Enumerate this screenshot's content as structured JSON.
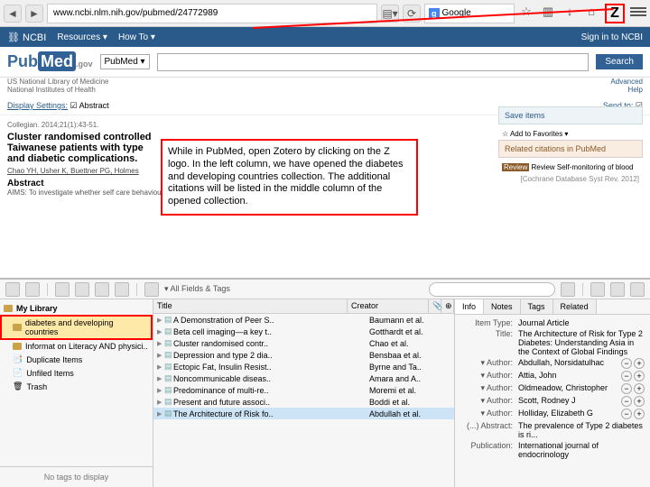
{
  "browser": {
    "url": "www.ncbi.nlm.nih.gov/pubmed/24772989",
    "search_engine": "Google",
    "search_prefix": "g"
  },
  "ncbi": {
    "brand": "NCBI",
    "resources": "Resources",
    "howto": "How To",
    "signin": "Sign in to NCBI"
  },
  "pubmed": {
    "logo_pub": "Pub",
    "logo_med": "Med",
    "logo_gov": ".gov",
    "select": "PubMed",
    "search_btn": "Search",
    "subtitle1": "US National Library of Medicine",
    "subtitle2": "National Institutes of Health",
    "advanced": "Advanced",
    "help": "Help",
    "display": "Display Settings:",
    "display_val": "Abstract",
    "sendto": "Send to:"
  },
  "article": {
    "journal": "Collegian. 2014;21(1):43-51.",
    "title": "Cluster randomised controlled",
    "title2": "Taiwanese patients with type",
    "title3": "and diabetic complications.",
    "authors": "Chao YH, Usher K, Buettner PG, Holmes",
    "abstract_hdr": "Abstract",
    "aims": "AIMS: To investigate whether self care behaviours..."
  },
  "side": {
    "save": "Save items",
    "fav": "Add to Favorites",
    "rel": "Related citations in PubMed",
    "rel_item": "Review Self-monitoring of blood",
    "rel_cite": "[Cochrane Database Syst Rev. 2012]"
  },
  "annotation": "While in PubMed, open Zotero by clicking on the Z logo. In the left column, we have opened the diabetes and developing countries collection. The additional citations will be listed in the middle column of the opened collection.",
  "zotero": {
    "filter_placeholder": "All Fields & Tags",
    "my_library": "My Library",
    "collections": [
      "diabetes and developing countries",
      "Informat on Literacy AND physici..",
      "Duplicate Items",
      "Unfiled Items",
      "Trash"
    ],
    "tags_empty": "No tags to display",
    "col_title": "Title",
    "col_creator": "Creator",
    "items": [
      {
        "t": "A Demonstration of Peer S..",
        "c": "Baumann et al."
      },
      {
        "t": "Beta cell imaging—a key t..",
        "c": "Gotthardt et al."
      },
      {
        "t": "Cluster randomised contr..",
        "c": "Chao et al."
      },
      {
        "t": "Depression and type 2 dia..",
        "c": "Bensbaa et al."
      },
      {
        "t": "Ectopic Fat, Insulin Resist..",
        "c": "Byrne and Ta.."
      },
      {
        "t": "Noncommunicable diseas..",
        "c": "Amara and A.."
      },
      {
        "t": "Predominance of multi-re..",
        "c": "Moremi et al."
      },
      {
        "t": "Present and future associ..",
        "c": "Boddi et al."
      },
      {
        "t": "The Architecture of Risk fo..",
        "c": "Abdullah et al."
      }
    ],
    "tabs": [
      "Info",
      "Notes",
      "Tags",
      "Related"
    ],
    "info": {
      "item_type_lbl": "Item Type:",
      "item_type": "Journal Article",
      "title_lbl": "Title:",
      "title": "The Architecture of Risk for Type 2 Diabetes: Understanding Asia in the Context of Global Findings",
      "author_lbl": "Author:",
      "authors": [
        "Abdullah, Norsidatulhac",
        "Attia, John",
        "Oldmeadow, Christopher",
        "Scott, Rodney J",
        "Holliday, Elizabeth G"
      ],
      "abstract_lbl": "(...) Abstract:",
      "abstract": "The prevalence of Type 2 diabetes is ri...",
      "publication_lbl": "Publication:",
      "publication": "International journal of endocrinology"
    }
  }
}
